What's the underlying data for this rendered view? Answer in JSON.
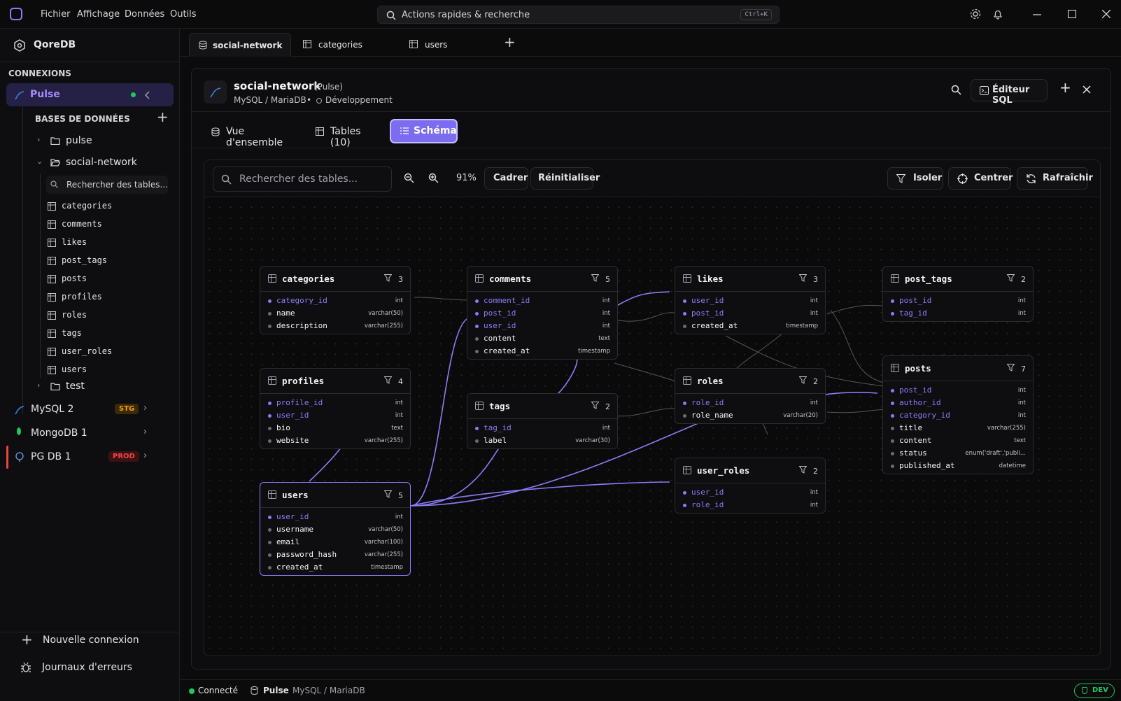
{
  "menu": [
    "Fichier",
    "Affichage",
    "Données",
    "Outils"
  ],
  "search": {
    "label": "Actions rapides & recherche",
    "shortcut": "Ctrl+K"
  },
  "app": {
    "name": "QoreDB"
  },
  "sidebar": {
    "section": "CONNEXIONS",
    "active_connection": "Pulse",
    "databases_label": "BASES DE DONNÉES",
    "databases": [
      {
        "name": "pulse"
      },
      {
        "name": "social-network"
      },
      {
        "name": "test"
      }
    ],
    "table_search_placeholder": "Rechercher des tables...",
    "tables": [
      "categories",
      "comments",
      "likes",
      "post_tags",
      "posts",
      "profiles",
      "roles",
      "tags",
      "user_roles",
      "users"
    ],
    "connections": [
      {
        "name": "MySQL 2",
        "badge": "STG",
        "badge_color": "#f59e0b"
      },
      {
        "name": "MongoDB 1",
        "badge": "",
        "badge_color": ""
      },
      {
        "name": "PG DB 1",
        "badge": "PROD",
        "badge_color": "#ef4444"
      }
    ],
    "new_connection": "Nouvelle connexion",
    "error_logs": "Journaux d'erreurs"
  },
  "tabs": [
    "social-network",
    "categories",
    "users"
  ],
  "header": {
    "db": "social-network",
    "conn": "(Pulse)",
    "engine": "MySQL / MariaDB",
    "env": "Développement",
    "sql_editor": "Éditeur SQL"
  },
  "subtabs": {
    "overview": "Vue d'ensemble",
    "tables": "Tables (10)",
    "schema": "Schéma"
  },
  "toolbar": {
    "search_placeholder": "Rechercher des tables...",
    "zoom": "91%",
    "frame": "Cadrer",
    "reset": "Réinitialiser",
    "isolate": "Isoler",
    "center": "Centrer",
    "refresh": "Rafraîchir"
  },
  "schema_tables": [
    {
      "name": "categories",
      "count": "3",
      "cols": [
        [
          "category_id",
          "int",
          true
        ],
        [
          "name",
          "varchar(50)",
          false
        ],
        [
          "description",
          "varchar(255)",
          false
        ]
      ]
    },
    {
      "name": "comments",
      "count": "5",
      "cols": [
        [
          "comment_id",
          "int",
          true
        ],
        [
          "post_id",
          "int",
          true
        ],
        [
          "user_id",
          "int",
          true
        ],
        [
          "content",
          "text",
          false
        ],
        [
          "created_at",
          "timestamp",
          false
        ]
      ]
    },
    {
      "name": "likes",
      "count": "3",
      "cols": [
        [
          "user_id",
          "int",
          true
        ],
        [
          "post_id",
          "int",
          true
        ],
        [
          "created_at",
          "timestamp",
          false
        ]
      ]
    },
    {
      "name": "post_tags",
      "count": "2",
      "cols": [
        [
          "post_id",
          "int",
          true
        ],
        [
          "tag_id",
          "int",
          true
        ]
      ]
    },
    {
      "name": "profiles",
      "count": "4",
      "cols": [
        [
          "profile_id",
          "int",
          true
        ],
        [
          "user_id",
          "int",
          true
        ],
        [
          "bio",
          "text",
          false
        ],
        [
          "website",
          "varchar(255)",
          false
        ]
      ]
    },
    {
      "name": "tags",
      "count": "2",
      "cols": [
        [
          "tag_id",
          "int",
          true
        ],
        [
          "label",
          "varchar(30)",
          false
        ]
      ]
    },
    {
      "name": "roles",
      "count": "2",
      "cols": [
        [
          "role_id",
          "int",
          true
        ],
        [
          "role_name",
          "varchar(20)",
          false
        ]
      ]
    },
    {
      "name": "posts",
      "count": "7",
      "cols": [
        [
          "post_id",
          "int",
          true
        ],
        [
          "author_id",
          "int",
          true
        ],
        [
          "category_id",
          "int",
          true
        ],
        [
          "title",
          "varchar(255)",
          false
        ],
        [
          "content",
          "text",
          false
        ],
        [
          "status",
          "enum('draft','publi...",
          false
        ],
        [
          "published_at",
          "datetime",
          false
        ]
      ]
    },
    {
      "name": "user_roles",
      "count": "2",
      "cols": [
        [
          "user_id",
          "int",
          true
        ],
        [
          "role_id",
          "int",
          true
        ]
      ]
    },
    {
      "name": "users",
      "count": "5",
      "cols": [
        [
          "user_id",
          "int",
          true
        ],
        [
          "username",
          "varchar(50)",
          false
        ],
        [
          "email",
          "varchar(100)",
          false
        ],
        [
          "password_hash",
          "varchar(255)",
          false
        ],
        [
          "created_at",
          "timestamp",
          false
        ]
      ]
    }
  ],
  "status": {
    "connected": "Connecté",
    "conn": "Pulse",
    "engine": "MySQL / MariaDB",
    "env": "DEV"
  }
}
